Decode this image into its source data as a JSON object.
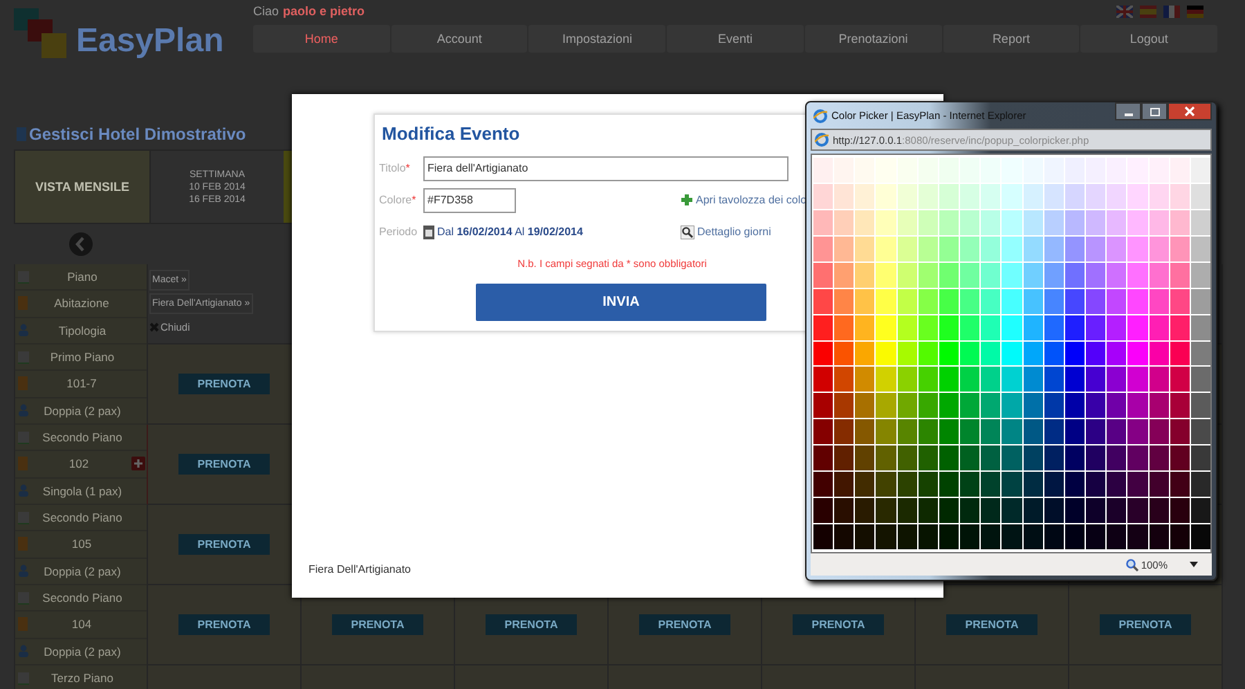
{
  "header": {
    "logo": "EasyPlan",
    "greeting": "Ciao",
    "user": "paolo e pietro",
    "nav": [
      {
        "label": "Home",
        "selected": true
      },
      {
        "label": "Account",
        "selected": false
      },
      {
        "label": "Impostazioni",
        "selected": false
      },
      {
        "label": "Eventi",
        "selected": false
      },
      {
        "label": "Prenotazioni",
        "selected": false
      },
      {
        "label": "Report",
        "selected": false
      },
      {
        "label": "Logout",
        "selected": false
      }
    ]
  },
  "page_title": "Gestisci Hotel Dimostrativo",
  "view": {
    "month_view": "VISTA MENSILE",
    "week_label": "SETTIMANA",
    "week_start": "10 FEB 2014",
    "week_end": "16 FEB 2014"
  },
  "table": {
    "header_labels": [
      "Piano",
      "Abitazione",
      "Tipologia"
    ],
    "event_links": [
      "Macet »",
      "Fiera Dell'Artigianato »"
    ],
    "close_label": "Chiudi",
    "rooms": [
      {
        "floor": "Primo Piano",
        "number": "101-7",
        "type": "Doppia (2 pax)",
        "flagged": false,
        "buttons": [
          "PRENOTA"
        ]
      },
      {
        "floor": "Secondo Piano",
        "number": "102",
        "type": "Singola (1 pax)",
        "flagged": true,
        "buttons": [
          "PRENOTA"
        ]
      },
      {
        "floor": "Secondo Piano",
        "number": "105",
        "type": "Doppia (2 pax)",
        "flagged": false,
        "buttons": [
          "PRENOTA"
        ]
      },
      {
        "floor": "Secondo Piano",
        "number": "104",
        "type": "Doppia (2 pax)",
        "flagged": false,
        "buttons": [
          "PRENOTA",
          "PRENOTA",
          "PRENOTA",
          "PRENOTA",
          "PRENOTA",
          "PRENOTA",
          "PRENOTA"
        ]
      },
      {
        "floor": "Terzo Piano",
        "flagged": false
      }
    ]
  },
  "modal": {
    "title": "Modifica Evento",
    "title_field": {
      "label": "Titolo",
      "required_mark": "*",
      "value": "Fiera dell'Artigianato"
    },
    "color_field": {
      "label": "Colore",
      "required_mark": "*",
      "value": "#F7D358",
      "link": "Apri tavolozza dei colo"
    },
    "period": {
      "label": "Periodo",
      "text": "Dal **16/02/2014** Al **19/02/2014**",
      "link": "Dettaglio giorni"
    },
    "note": "N.b. I campi segnati da * sono obbligatori",
    "submit": "INVIA",
    "footer": "Fiera Dell'Artigianato"
  },
  "popup": {
    "title": "Color Picker | EasyPlan - Internet Explorer",
    "url_host": "http://127.0.0.1",
    "url_rest": ":8080/reserve/inc/popup_colorpicker.php",
    "zoom": "100%"
  }
}
